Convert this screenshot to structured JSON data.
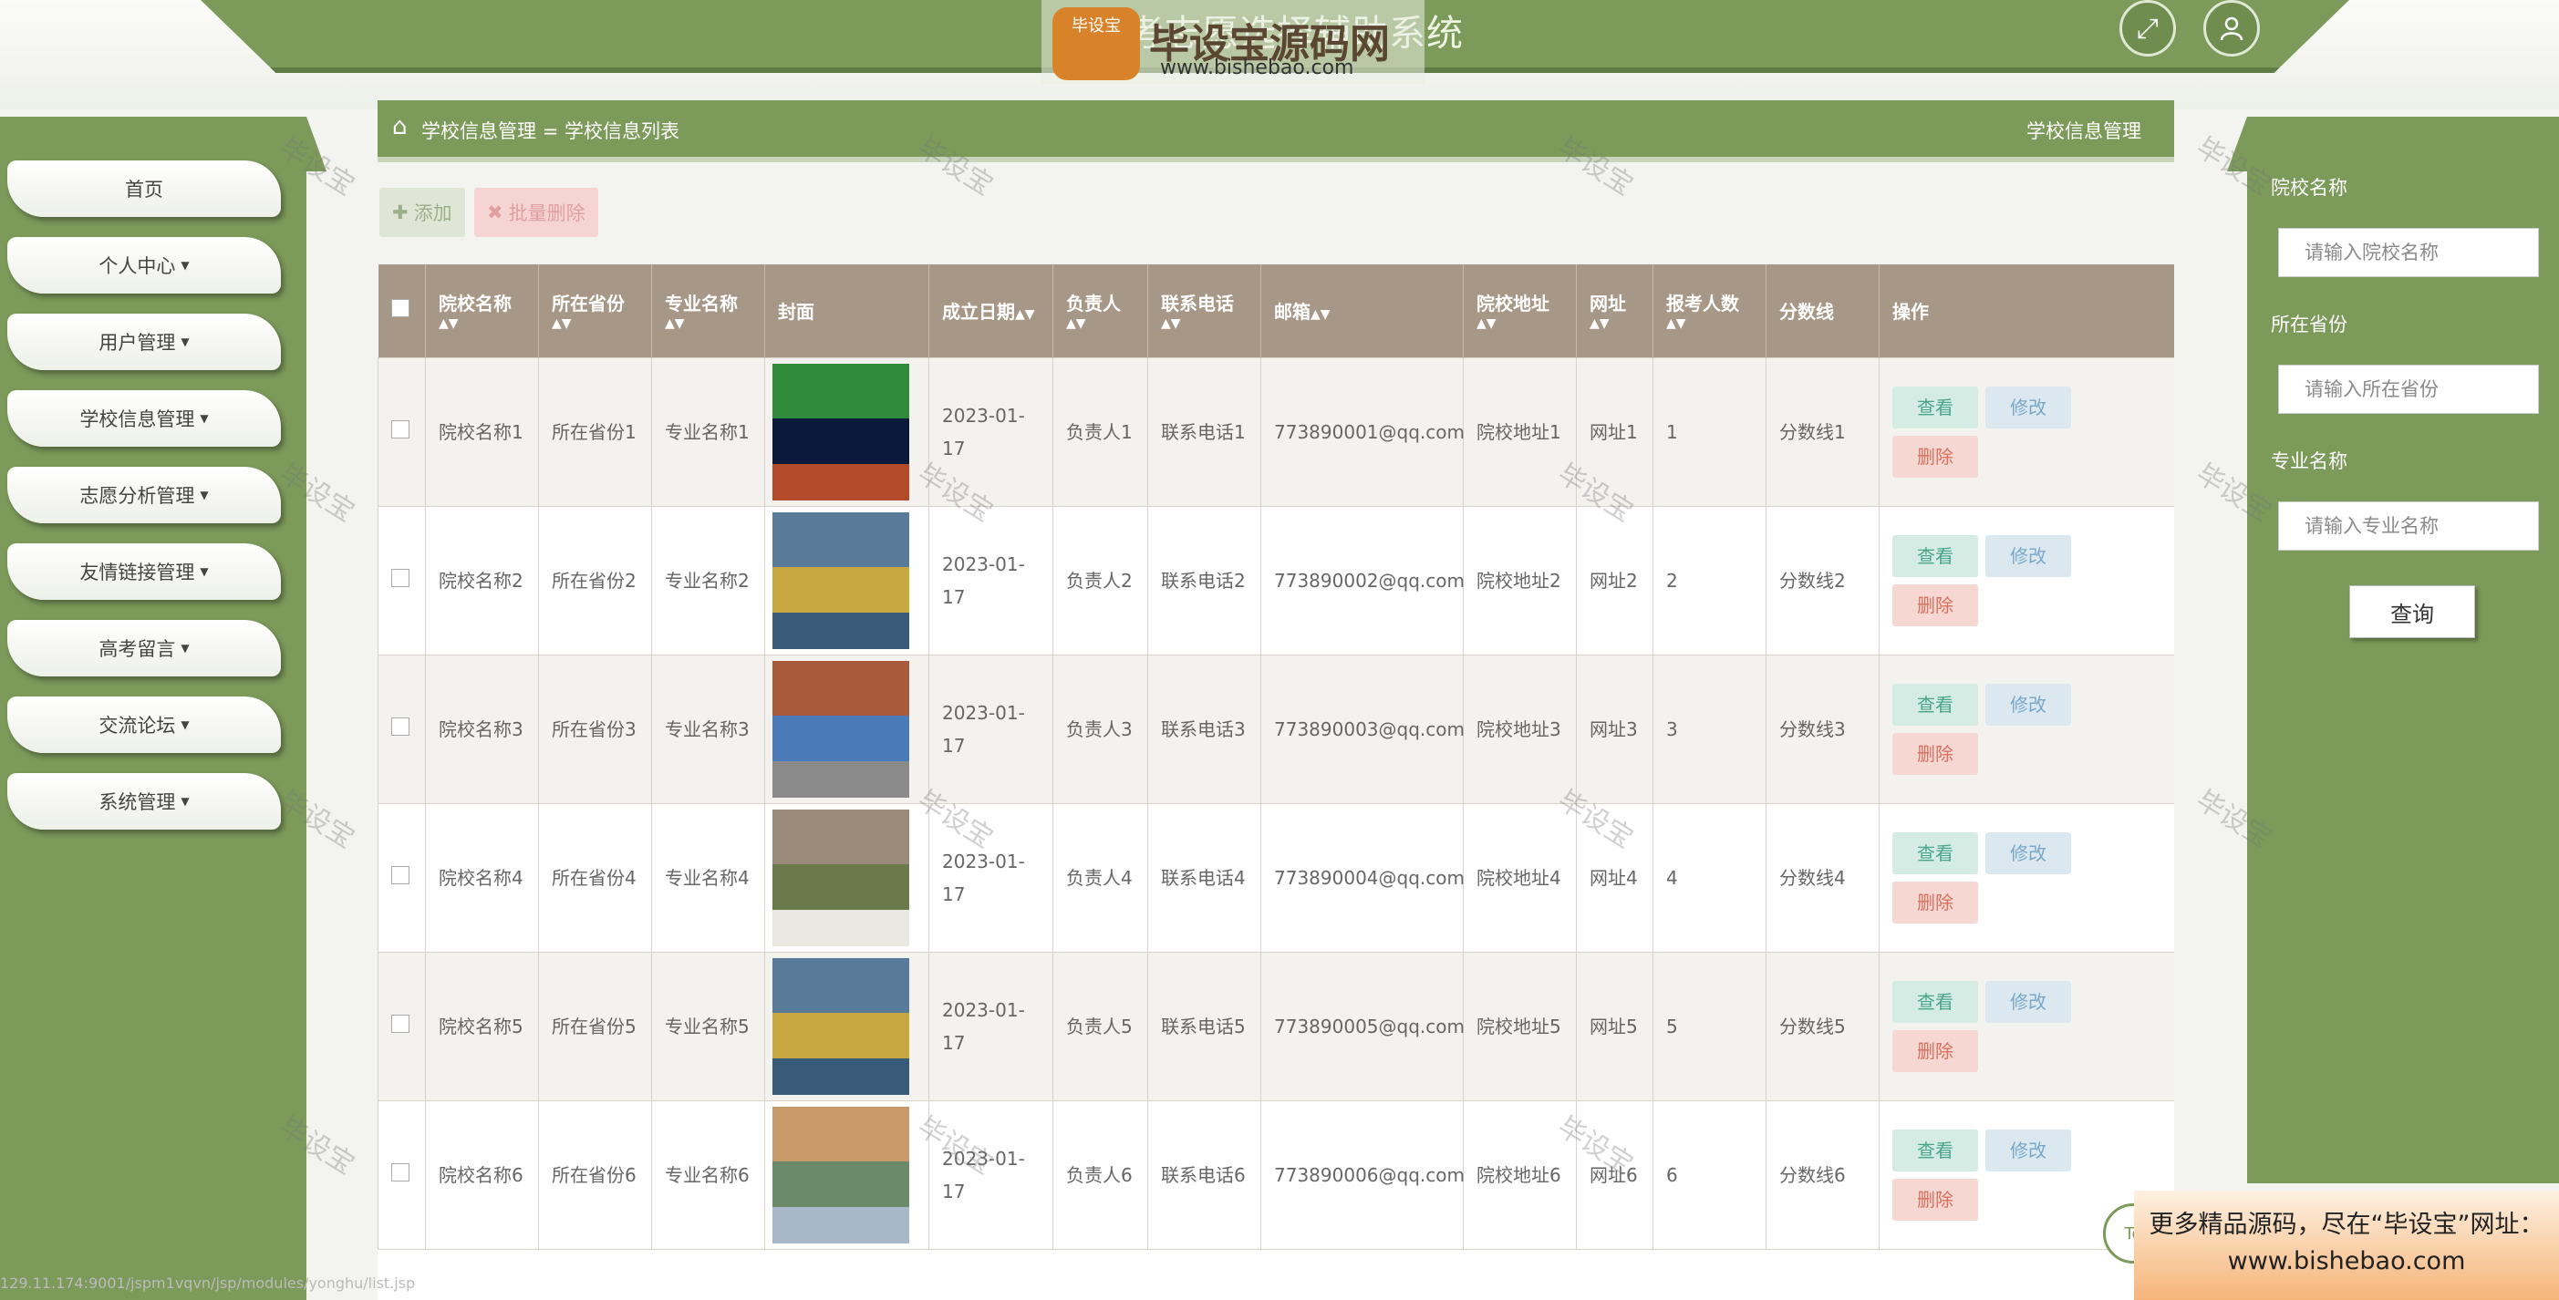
{
  "header": {
    "title": "高考志愿选择辅助系统",
    "logo_seal": "毕设宝",
    "logo_name": "毕设宝源码网",
    "logo_url": "www.bishebao.com",
    "fullscreen_icon": "expand-icon",
    "user_icon": "user-icon"
  },
  "sidebar": {
    "items": [
      {
        "label": "首页"
      },
      {
        "label": "个人中心"
      },
      {
        "label": "用户管理"
      },
      {
        "label": "学校信息管理"
      },
      {
        "label": "志愿分析管理"
      },
      {
        "label": "友情链接管理"
      },
      {
        "label": "高考留言"
      },
      {
        "label": "交流论坛"
      },
      {
        "label": "系统管理"
      }
    ]
  },
  "breadcrumb": {
    "part1": "学校信息管理",
    "sep": "=",
    "part2": "学校信息列表",
    "right_title": "学校信息管理"
  },
  "toolbar": {
    "add_label": "添加",
    "batch_delete_label": "批量删除"
  },
  "table": {
    "headers": [
      "院校名称",
      "所在省份",
      "专业名称",
      "封面",
      "成立日期",
      "负责人",
      "联系电话",
      "邮箱",
      "院校地址",
      "网址",
      "报考人数",
      "分数线",
      "操作"
    ],
    "rows": [
      {
        "name": "院校名称1",
        "province": "所在省份1",
        "major": "专业名称1",
        "date": "2023-01-17",
        "leader": "负责人1",
        "phone": "联系电话1",
        "email": "773890001@qq.com",
        "address": "院校地址1",
        "site": "网址1",
        "count": "1",
        "score": "分数线1"
      },
      {
        "name": "院校名称2",
        "province": "所在省份2",
        "major": "专业名称2",
        "date": "2023-01-17",
        "leader": "负责人2",
        "phone": "联系电话2",
        "email": "773890002@qq.com",
        "address": "院校地址2",
        "site": "网址2",
        "count": "2",
        "score": "分数线2"
      },
      {
        "name": "院校名称3",
        "province": "所在省份3",
        "major": "专业名称3",
        "date": "2023-01-17",
        "leader": "负责人3",
        "phone": "联系电话3",
        "email": "773890003@qq.com",
        "address": "院校地址3",
        "site": "网址3",
        "count": "3",
        "score": "分数线3"
      },
      {
        "name": "院校名称4",
        "province": "所在省份4",
        "major": "专业名称4",
        "date": "2023-01-17",
        "leader": "负责人4",
        "phone": "联系电话4",
        "email": "773890004@qq.com",
        "address": "院校地址4",
        "site": "网址4",
        "count": "4",
        "score": "分数线4"
      },
      {
        "name": "院校名称5",
        "province": "所在省份5",
        "major": "专业名称5",
        "date": "2023-01-17",
        "leader": "负责人5",
        "phone": "联系电话5",
        "email": "773890005@qq.com",
        "address": "院校地址5",
        "site": "网址5",
        "count": "5",
        "score": "分数线5"
      },
      {
        "name": "院校名称6",
        "province": "所在省份6",
        "major": "专业名称6",
        "date": "2023-01-17",
        "leader": "负责人6",
        "phone": "联系电话6",
        "email": "773890006@qq.com",
        "address": "院校地址6",
        "site": "网址6",
        "count": "6",
        "score": "分数线6"
      }
    ],
    "actions": {
      "view": "查看",
      "edit": "修改",
      "delete": "删除"
    }
  },
  "search": {
    "fields": [
      {
        "label": "院校名称",
        "placeholder": "请输入院校名称"
      },
      {
        "label": "所在省份",
        "placeholder": "请输入所在省份"
      },
      {
        "label": "专业名称",
        "placeholder": "请输入专业名称"
      }
    ],
    "button": "查询"
  },
  "watermark_text": "毕设宝",
  "promo": {
    "line1": "更多精品源码，尽在“毕设宝”网址：",
    "line2": "www.bishebao.com"
  },
  "status_url": "129.11.174:9001/jspm1vqvn/jsp/modules/yonghu/list.jsp",
  "back_to_top": "To",
  "colors": {
    "primary": "#7c9a5a",
    "table_header": "#a69786"
  }
}
